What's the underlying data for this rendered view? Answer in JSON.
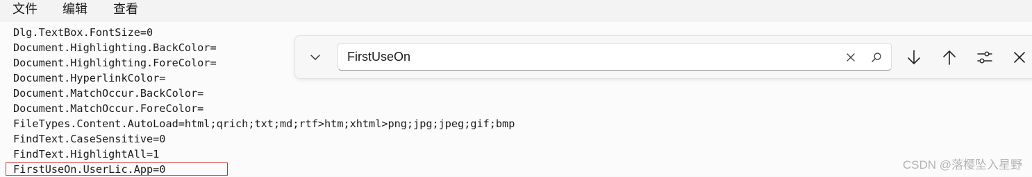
{
  "menu": {
    "file": "文件",
    "edit": "编辑",
    "view": "查看"
  },
  "editor": {
    "lines": [
      "Dlg.TextBox.FontSize=0",
      "Document.Highlighting.BackColor=",
      "Document.Highlighting.ForeColor=",
      "Document.HyperlinkColor=",
      "Document.MatchOccur.BackColor=",
      "Document.MatchOccur.ForeColor=",
      "FileTypes.Content.AutoLoad=html;qrich;txt;md;rtf>htm;xhtml>png;jpg;jpeg;gif;bmp",
      "FindText.CaseSensitive=0",
      "FindText.HighlightAll=1",
      "FirstUseOn.UserLic.App=0"
    ]
  },
  "find": {
    "value": "FirstUseOn",
    "icons": {
      "expand": "chevron-down-icon",
      "clear": "close-icon",
      "search": "search-icon",
      "next": "arrow-down-icon",
      "previous": "arrow-up-icon",
      "options": "sliders-icon",
      "close": "close-icon"
    }
  },
  "watermark": "CSDN @落樱坠入星野",
  "colors": {
    "highlight_border": "#d12c2c",
    "menubar_bg": "#f3f3f3",
    "editor_bg": "#fbfbfb"
  }
}
